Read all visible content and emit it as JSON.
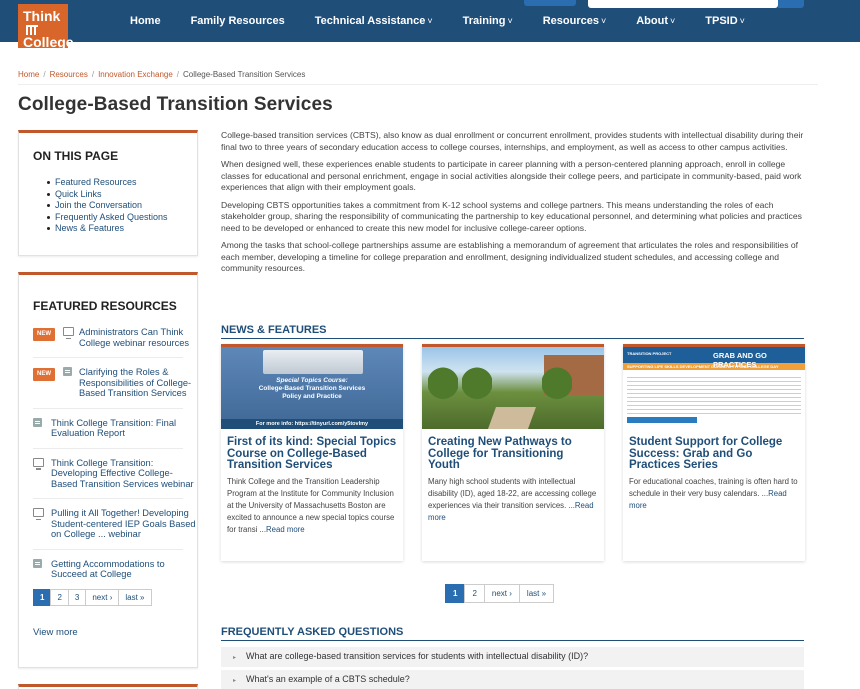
{
  "logo": {
    "line1": "Think",
    "line2": "College"
  },
  "nav": {
    "items": [
      {
        "label": "Home",
        "caret": ""
      },
      {
        "label": "Family Resources",
        "caret": ""
      },
      {
        "label": "Technical Assistance",
        "caret": "˅"
      },
      {
        "label": "Training",
        "caret": "˅"
      },
      {
        "label": "Resources",
        "caret": "˅"
      },
      {
        "label": "About",
        "caret": "˅"
      },
      {
        "label": "TPSID",
        "caret": "˅"
      }
    ]
  },
  "breadcrumb": [
    "Home",
    "Resources",
    "Innovation Exchange",
    "College-Based Transition Services"
  ],
  "page_title": "College-Based Transition Services",
  "on_this_page": {
    "heading": "ON THIS PAGE",
    "items": [
      "Featured Resources",
      "Quick Links",
      "Join the Conversation",
      "Frequently Asked Questions",
      "News & Features"
    ]
  },
  "featured_resources": {
    "heading": "FEATURED RESOURCES",
    "new_label": "NEW",
    "items": [
      {
        "title": "Administrators Can Think College webinar resources",
        "icon": "monitor-icon"
      },
      {
        "title": "Clarifying the Roles & Responsibilities of College-Based Transition Services",
        "icon": "document-icon"
      },
      {
        "title": "Think College Transition: Final Evaluation Report",
        "icon": "document-icon"
      },
      {
        "title": "Think College Transition: Developing Effective College-Based Transition Services webinar",
        "icon": "monitor-icon"
      },
      {
        "title": "Pulling it All Together! Developing Student-centered IEP Goals Based on College ... webinar",
        "icon": "monitor-icon"
      },
      {
        "title": "Getting Accommodations to Succeed at College",
        "icon": "document-icon"
      }
    ],
    "pager": [
      "1",
      "2",
      "3",
      "next ›",
      "last »"
    ],
    "view_more": "View more"
  },
  "intro": [
    "College-based transition services (CBTS), also know as dual enrollment or concurrent enrollment, provides students with intellectual disability during their final two to three years of secondary education access to college courses, internships, and employment, as well as access to other campus activities.",
    "When designed well, these experiences enable students to participate in career planning with a person-centered planning approach, enroll in college classes for educational and personal enrichment, engage in social activities alongside their college peers, and participate in community-based, paid work experiences that align with their employment goals.",
    "Developing CBTS opportunities takes a commitment from K-12 school systems and college partners. This means understanding the roles of each stakeholder group, sharing the responsibility of communicating the partnership to key educational personnel, and determining what policies and practices need to be developed or enhanced to create this new model for inclusive college-career options.",
    "Among the tasks that school-college partnerships assume are establishing a memorandum of agreement that articulates the roles and responsibilities of each member, developing a timeline for college preparation and enrollment, designing individualized student schedules, and accessing college and community resources."
  ],
  "news": {
    "heading": "NEWS & FEATURES",
    "read_more": "...Read more",
    "cards": [
      {
        "thumb_title_1": "Special Topics Course:",
        "thumb_title_2": "College-Based Transition Services",
        "thumb_title_3": "Policy and Practice",
        "thumb_footer": "For more info: https://tinyurl.com/y5tovlmy",
        "title": "First of its kind: Special Topics Course on College-Based Transition Services",
        "text": "Think College and the Transition Leadership Program at the Institute for Community Inclusion at the University of Massachusetts Boston are excited to announce a new special topics course for transi"
      },
      {
        "title": "Creating New Pathways to College for Transitioning Youth",
        "text": "Many high school students with intellectual disability (ID), aged 18-22, are accessing college experiences via their transition services."
      },
      {
        "thumb_header_small": "TRANSITION PROJECT",
        "thumb_header": "GRAB AND GO PRACTICES",
        "thumb_sub": "SUPPORTING LIFE SKILLS DEVELOPMENT DURING A TYPICAL COLLEGE DAY",
        "title": "Student Support for College Success: Grab and Go Practices Series",
        "text": "For educational coaches, training is often hard to schedule in their very busy calendars."
      }
    ],
    "pager": [
      "1",
      "2",
      "next ›",
      "last »"
    ]
  },
  "faq": {
    "heading": "FREQUENTLY ASKED QUESTIONS",
    "items": [
      "What are college-based transition services for students with intellectual disability (ID)?",
      "What's an example of a CBTS schedule?"
    ]
  },
  "colors": {
    "header": "#1f4e79",
    "accent": "#c0582b",
    "link": "#1f4e79",
    "badge": "#e06f34",
    "pager_active": "#2a6db1"
  }
}
